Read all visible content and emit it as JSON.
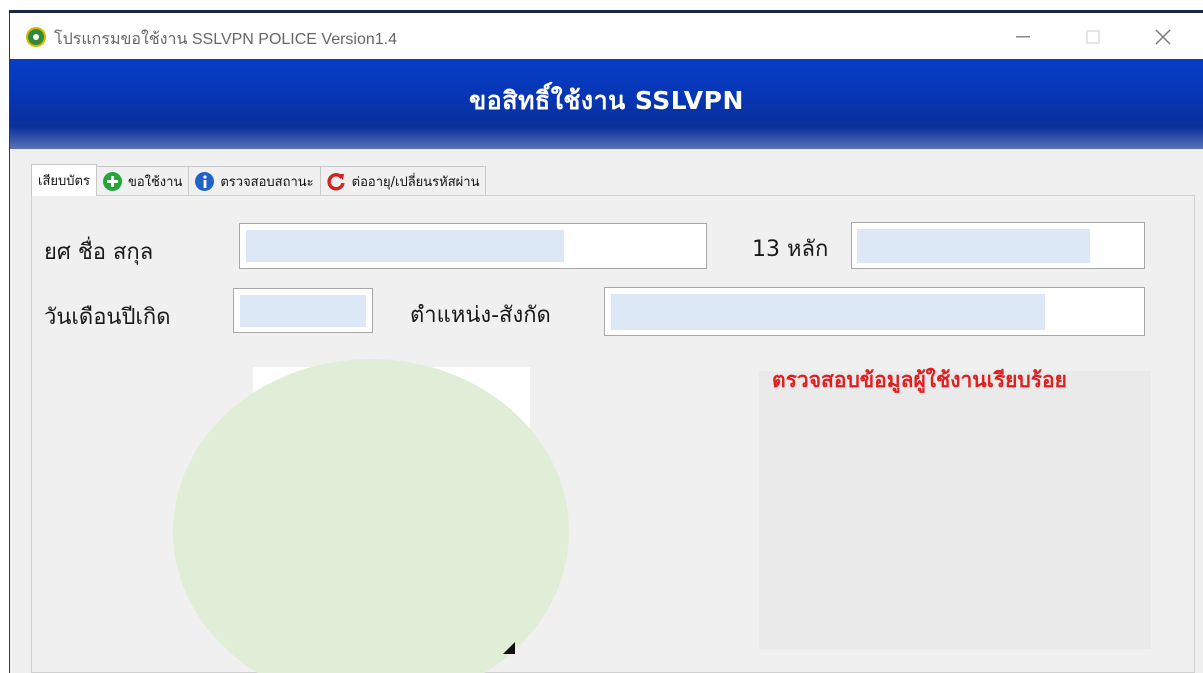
{
  "window": {
    "title": "โปรแกรมขอใช้งาน SSLVPN POLICE Version1.4",
    "controls": {
      "minimize": "—",
      "maximize": "☐",
      "close": "✕"
    }
  },
  "banner": {
    "title": "ขอสิทธิ์ใช้งาน SSLVPN"
  },
  "tabs": [
    {
      "label": "เสียบบัตร",
      "icon": "none",
      "active": true
    },
    {
      "label": "ขอใช้งาน",
      "icon": "plus-circle-icon",
      "active": false
    },
    {
      "label": "ตรวจสอบสถานะ",
      "icon": "info-icon",
      "active": false
    },
    {
      "label": "ต่ออายุ/เปลี่ยนรหัสผ่าน",
      "icon": "refresh-icon",
      "active": false
    }
  ],
  "form": {
    "name_label": "ยศ ชื่อ สกุล",
    "name_value": "",
    "id_label": "13 หลัก",
    "id_value": "",
    "dob_label": "วันเดือนปีเกิด",
    "dob_value": "",
    "position_label": "ตำแหน่ง-สังกัด",
    "position_value": ""
  },
  "status": {
    "message": "ตรวจสอบข้อมูลผู้ใช้งานเรียบร้อย",
    "color": "#e02020"
  },
  "colors": {
    "banner": "#0636b5",
    "status_text": "#e02020",
    "redaction_fill": "#dde8f6",
    "redaction_blob": "#e0edd7"
  }
}
